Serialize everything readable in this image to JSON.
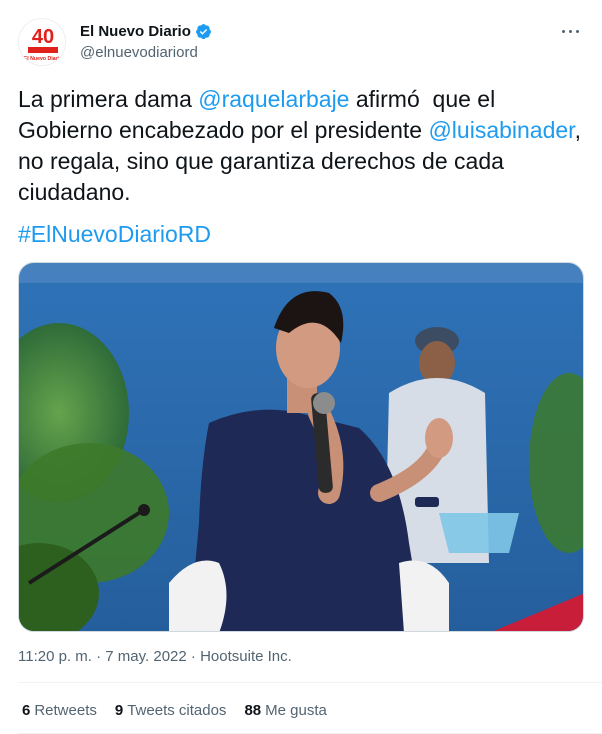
{
  "account": {
    "name": "El Nuevo Diario",
    "handle": "@elnuevodiariord",
    "logo_number": "40",
    "logo_text": "El Nuevo Diario"
  },
  "tweet": {
    "text_1": "La primera dama ",
    "mention_1": "@raquelarbaje",
    "text_2": " afirmó  que el\nGobierno encabezado por el presidente ",
    "mention_2": "@luisabinader",
    "text_3": ",\nno regala, sino que garantiza derechos de cada\nciudadano.",
    "hashtag": "#ElNuevoDiarioRD"
  },
  "meta": {
    "time": "11:20 p. m.",
    "sep": " · ",
    "date": "7 may. 2022",
    "source": "Hootsuite Inc."
  },
  "stats": {
    "retweets_count": "6",
    "retweets_label": "Retweets",
    "quotes_count": "9",
    "quotes_label": "Tweets citados",
    "likes_count": "88",
    "likes_label": "Me gusta"
  },
  "colors": {
    "accent": "#1d9bf0",
    "text": "#0f1419",
    "muted": "#536471",
    "logo_red": "#e0201b"
  },
  "icons": {
    "verified": "verified-badge-icon",
    "more": "more-horizontal-icon"
  }
}
